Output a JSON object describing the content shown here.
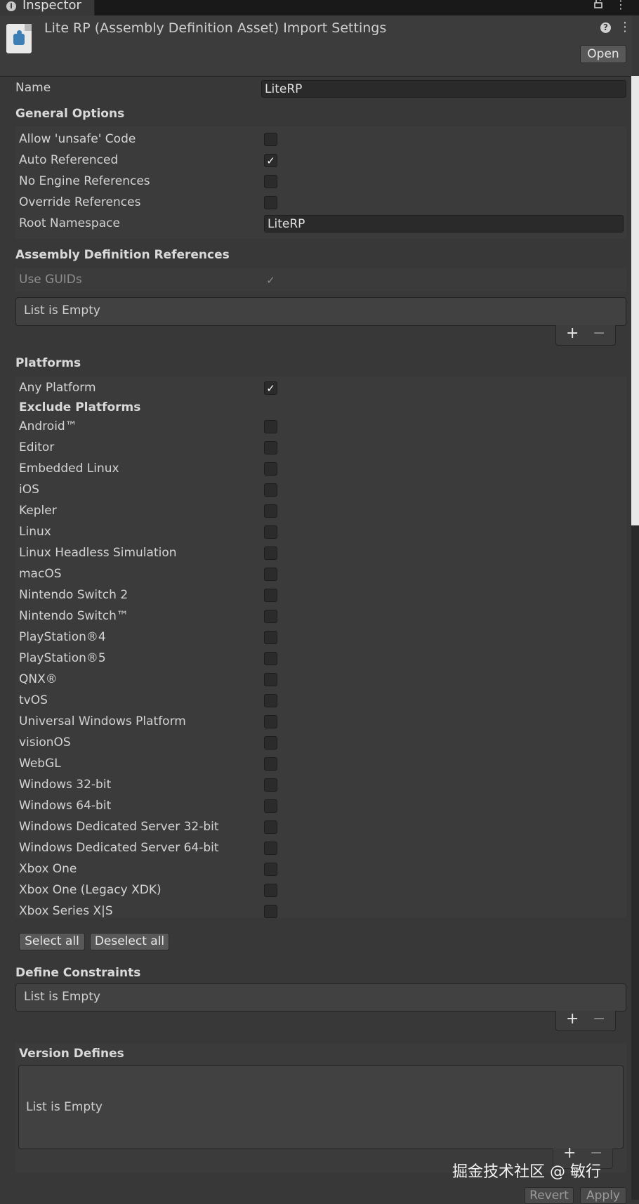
{
  "tab": {
    "label": "Inspector"
  },
  "header": {
    "title": "Lite RP (Assembly Definition Asset) Import Settings",
    "open_label": "Open"
  },
  "name_field": {
    "label": "Name",
    "value": "LiteRP"
  },
  "general_options": {
    "title": "General Options",
    "allow_unsafe": {
      "label": "Allow 'unsafe' Code",
      "checked": false
    },
    "auto_referenced": {
      "label": "Auto Referenced",
      "checked": true
    },
    "no_engine_refs": {
      "label": "No Engine References",
      "checked": false
    },
    "override_refs": {
      "label": "Override References",
      "checked": false
    },
    "root_namespace": {
      "label": "Root Namespace",
      "value": "LiteRP"
    }
  },
  "assembly_refs": {
    "title": "Assembly Definition References",
    "use_guids": {
      "label": "Use GUIDs",
      "checked": true
    },
    "empty_text": "List is Empty"
  },
  "platforms": {
    "title": "Platforms",
    "any_platform": {
      "label": "Any Platform",
      "checked": true
    },
    "exclude_title": "Exclude Platforms",
    "items": [
      "Android™",
      "Editor",
      "Embedded Linux",
      "iOS",
      "Kepler",
      "Linux",
      "Linux Headless Simulation",
      "macOS",
      "Nintendo Switch 2",
      "Nintendo Switch™",
      "PlayStation®4",
      "PlayStation®5",
      "QNX®",
      "tvOS",
      "Universal Windows Platform",
      "visionOS",
      "WebGL",
      "Windows 32-bit",
      "Windows 64-bit",
      "Windows Dedicated Server 32-bit",
      "Windows Dedicated Server 64-bit",
      "Xbox One",
      "Xbox One (Legacy XDK)",
      "Xbox Series X|S"
    ],
    "select_all": "Select all",
    "deselect_all": "Deselect all"
  },
  "define_constraints": {
    "title": "Define Constraints",
    "empty_text": "List is Empty"
  },
  "version_defines": {
    "title": "Version Defines",
    "empty_text": "List is Empty"
  },
  "list_controls": {
    "plus": "+",
    "minus": "−"
  },
  "footer": {
    "revert": "Revert",
    "apply": "Apply"
  },
  "watermark": "掘金技术社区 @ 敏行"
}
